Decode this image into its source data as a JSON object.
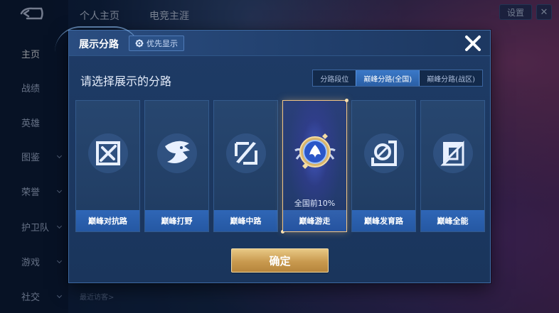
{
  "background": {
    "nav": {
      "items": [
        {
          "label": "主页",
          "active": true,
          "chevron": false
        },
        {
          "label": "战绩",
          "active": false,
          "chevron": false
        },
        {
          "label": "英雄",
          "active": false,
          "chevron": false
        },
        {
          "label": "图鉴",
          "active": false,
          "chevron": true
        },
        {
          "label": "荣誉",
          "active": false,
          "chevron": true
        },
        {
          "label": "护卫队",
          "active": false,
          "chevron": true
        },
        {
          "label": "游戏",
          "active": false,
          "chevron": true
        },
        {
          "label": "社交",
          "active": false,
          "chevron": true
        }
      ]
    },
    "tabs": [
      "个人主页",
      "电竞主涯"
    ],
    "settings_label": "设置",
    "recent_visitors": "最近访客>"
  },
  "modal": {
    "title": "展示分路",
    "priority_label": "优先显示",
    "subtitle": "请选择展示的分路",
    "segments": [
      {
        "label": "分路段位",
        "active": false
      },
      {
        "label": "巅峰分路(全国)",
        "active": true
      },
      {
        "label": "巅峰分路(战区)",
        "active": false
      }
    ],
    "cards": [
      {
        "label": "巅峰对抗路",
        "icon": "clash-lane-icon",
        "selected": false,
        "note": ""
      },
      {
        "label": "巅峰打野",
        "icon": "jungle-icon",
        "selected": false,
        "note": ""
      },
      {
        "label": "巅峰中路",
        "icon": "mid-lane-icon",
        "selected": false,
        "note": ""
      },
      {
        "label": "巅峰游走",
        "icon": "roam-icon",
        "selected": true,
        "note": "全国前10%"
      },
      {
        "label": "巅峰发育路",
        "icon": "farm-lane-icon",
        "selected": false,
        "note": ""
      },
      {
        "label": "巅峰全能",
        "icon": "all-round-icon",
        "selected": false,
        "note": ""
      }
    ],
    "confirm_label": "确定"
  },
  "colors": {
    "modal_bg": "#1e3b66",
    "card_bar": "#2f66b6",
    "selected_border": "#f2c584",
    "confirm": "#c99a4f"
  }
}
